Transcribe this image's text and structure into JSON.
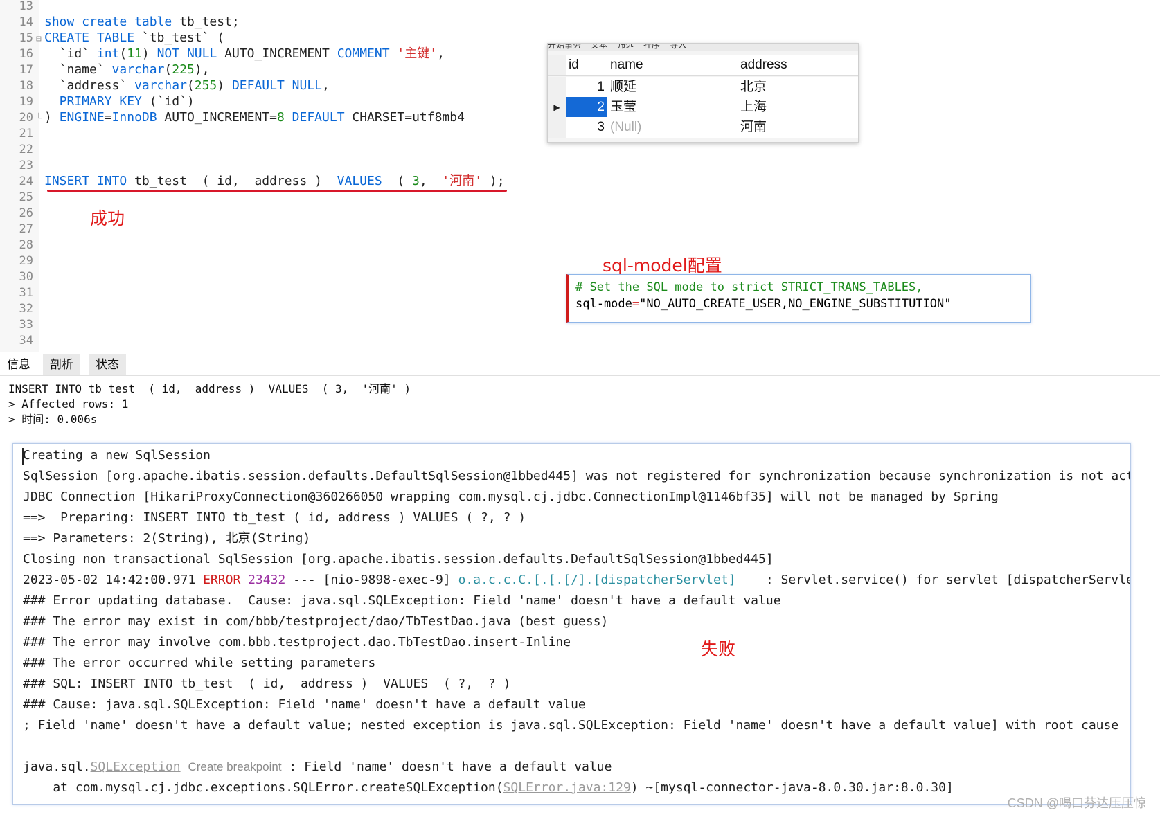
{
  "editor": {
    "lines": [
      {
        "num": "13",
        "text": ""
      },
      {
        "num": "14",
        "parts": [
          [
            "kw",
            "show create table"
          ],
          [
            "code",
            " tb_test;"
          ]
        ]
      },
      {
        "num": "15",
        "fold": "⊟",
        "parts": [
          [
            "kw",
            "CREATE TABLE"
          ],
          [
            "code",
            " `tb_test` ("
          ]
        ]
      },
      {
        "num": "16",
        "parts": [
          [
            "code",
            "  `id` "
          ],
          [
            "kw",
            "int"
          ],
          [
            "code",
            "("
          ],
          [
            "num",
            "11"
          ],
          [
            "code",
            ") "
          ],
          [
            "kw",
            "NOT NULL"
          ],
          [
            "code",
            " AUTO_INCREMENT "
          ],
          [
            "kw",
            "COMMENT"
          ],
          [
            "code",
            " "
          ],
          [
            "str",
            "'主键'"
          ],
          [
            "code",
            ","
          ]
        ]
      },
      {
        "num": "17",
        "parts": [
          [
            "code",
            "  `name` "
          ],
          [
            "kw",
            "varchar"
          ],
          [
            "code",
            "("
          ],
          [
            "num",
            "225"
          ],
          [
            "code",
            "),"
          ]
        ]
      },
      {
        "num": "18",
        "parts": [
          [
            "code",
            "  `address` "
          ],
          [
            "kw",
            "varchar"
          ],
          [
            "code",
            "("
          ],
          [
            "num",
            "255"
          ],
          [
            "code",
            ") "
          ],
          [
            "kw",
            "DEFAULT NULL"
          ],
          [
            "code",
            ","
          ]
        ]
      },
      {
        "num": "19",
        "parts": [
          [
            "kw",
            "  PRIMARY KEY"
          ],
          [
            "code",
            " (`id`)"
          ]
        ]
      },
      {
        "num": "20",
        "fold": "└",
        "parts": [
          [
            "code",
            ") "
          ],
          [
            "kw",
            "ENGINE"
          ],
          [
            "code",
            "="
          ],
          [
            "kw",
            "InnoDB"
          ],
          [
            "code",
            " AUTO_INCREMENT="
          ],
          [
            "num",
            "8"
          ],
          [
            "code",
            " "
          ],
          [
            "kw",
            "DEFAULT"
          ],
          [
            "code",
            " CHARSET=utf8mb4"
          ]
        ]
      },
      {
        "num": "21",
        "text": ""
      },
      {
        "num": "22",
        "text": ""
      },
      {
        "num": "23",
        "text": ""
      },
      {
        "num": "24",
        "parts": [
          [
            "kw",
            "INSERT INTO"
          ],
          [
            "code",
            " tb_test  ( id,  address )  "
          ],
          [
            "kw",
            "VALUES"
          ],
          [
            "code",
            "  ( "
          ],
          [
            "num",
            "3"
          ],
          [
            "code",
            ",  "
          ],
          [
            "str",
            "'河南'"
          ],
          [
            "code",
            " );"
          ]
        ]
      },
      {
        "num": "25",
        "text": ""
      },
      {
        "num": "26",
        "text": ""
      },
      {
        "num": "27",
        "text": ""
      },
      {
        "num": "28",
        "text": ""
      },
      {
        "num": "29",
        "text": ""
      },
      {
        "num": "30",
        "text": ""
      },
      {
        "num": "31",
        "text": ""
      },
      {
        "num": "32",
        "text": ""
      },
      {
        "num": "33",
        "text": ""
      },
      {
        "num": "34",
        "text": ""
      }
    ],
    "success_note": "成功",
    "sqlmode_note": "sql-model配置",
    "fail_note": "失败"
  },
  "grid": {
    "toolbar": [
      "开始事务",
      "文本",
      "筛选",
      "排序",
      "导入"
    ],
    "headers": {
      "id": "id",
      "name": "name",
      "address": "address"
    },
    "rows": [
      {
        "id": "1",
        "name": "顺延",
        "address": "北京",
        "current": false,
        "null_name": false
      },
      {
        "id": "2",
        "name": "玉莹",
        "address": "上海",
        "current": true,
        "null_name": false
      },
      {
        "id": "3",
        "name": "(Null)",
        "address": "河南",
        "current": false,
        "null_name": true
      }
    ],
    "row_marker": "▶"
  },
  "sqlmode": {
    "comment": "# Set the SQL mode to strict STRICT_TRANS_TABLES,",
    "key": "sql-mode",
    "eq": "=",
    "value": "\"NO_AUTO_CREATE_USER,NO_ENGINE_SUBSTITUTION\""
  },
  "tabs": [
    {
      "label": "信息",
      "active": true
    },
    {
      "label": "剖析",
      "active": false
    },
    {
      "label": "状态",
      "active": false
    }
  ],
  "output": [
    "INSERT INTO tb_test  ( id,  address )  VALUES  ( 3,  '河南' )",
    "> Affected rows: 1",
    "> 时间: 0.006s"
  ],
  "console": {
    "l1": "Creating a new SqlSession",
    "l2": "SqlSession [org.apache.ibatis.session.defaults.DefaultSqlSession@1bbed445] was not registered for synchronization because synchronization is not act",
    "l3": "JDBC Connection [HikariProxyConnection@360266050 wrapping com.mysql.cj.jdbc.ConnectionImpl@1146bf35] will not be managed by Spring",
    "l4": "==>  Preparing: INSERT INTO tb_test ( id, address ) VALUES ( ?, ? )",
    "l5": "==> Parameters: 2(String), 北京(String)",
    "l6": "Closing non transactional SqlSession [org.apache.ibatis.session.defaults.DefaultSqlSession@1bbed445]",
    "l7_time": "2023-05-02 14:42:00.971 ",
    "l7_level": "ERROR",
    "l7_pid": " 23432",
    "l7_mid": " --- [nio-9898-exec-9] ",
    "l7_logger": "o.a.c.c.C.[.[.[/].[dispatcherServlet]",
    "l7_tail": "    : Servlet.service() for servlet [dispatcherServle",
    "l8": "### Error updating database.  Cause: java.sql.SQLException: Field 'name' doesn't have a default value",
    "l9": "### The error may exist in com/bbb/testproject/dao/TbTestDao.java (best guess)",
    "l10": "### The error may involve com.bbb.testproject.dao.TbTestDao.insert-Inline",
    "l11": "### The error occurred while setting parameters",
    "l12": "### SQL: INSERT INTO tb_test  ( id,  address )  VALUES  ( ?,  ? )",
    "l13": "### Cause: java.sql.SQLException: Field 'name' doesn't have a default value",
    "l14": "; Field 'name' doesn't have a default value; nested exception is java.sql.SQLException: Field 'name' doesn't have a default value] with root cause",
    "l15_pre": "java.sql.",
    "l15_link": "SQLException",
    "l15_hint": "Create breakpoint",
    "l15_post": " : Field 'name' doesn't have a default value",
    "l16_pre": "    at com.mysql.cj.jdbc.exceptions.SQLError.createSQLException(",
    "l16_link": "SQLError.java:129",
    "l16_post": ") ~[mysql-connector-java-8.0.30.jar:8.0.30]"
  },
  "watermark": "CSDN @喝口芬达压压惊",
  "colors": {
    "keyword": "#0a67d6",
    "number": "#1a8a1a",
    "string": "#d22d2d",
    "error": "#d01c1c",
    "selection": "#1469d6"
  }
}
